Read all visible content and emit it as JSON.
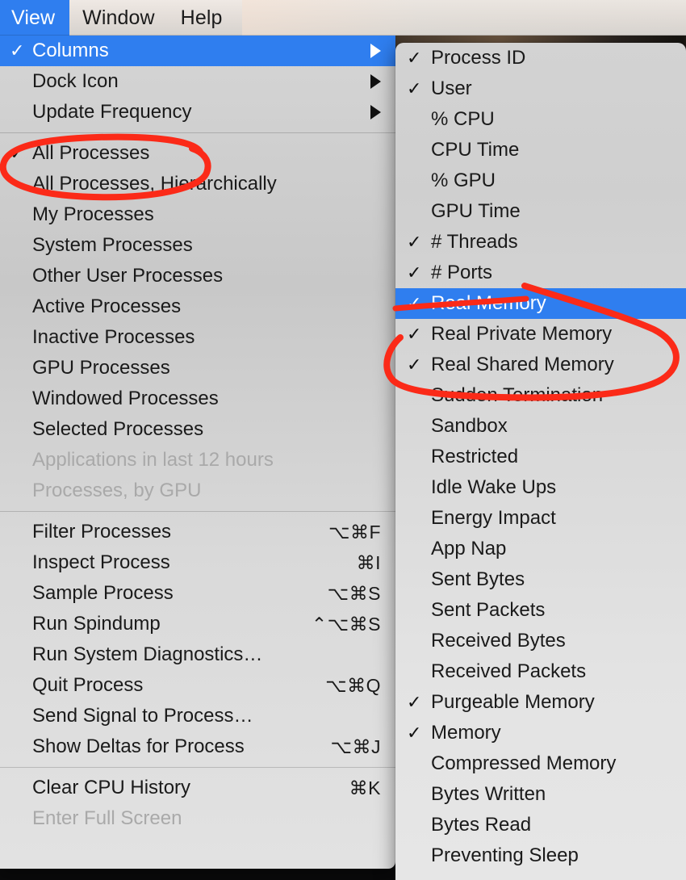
{
  "menubar": {
    "items": [
      {
        "label": "View",
        "active": true
      },
      {
        "label": "Window",
        "active": false
      },
      {
        "label": "Help",
        "active": false
      }
    ]
  },
  "view_menu": {
    "name": "View",
    "groups": [
      {
        "items": [
          {
            "label": "Columns",
            "checked": true,
            "submenu": true,
            "highlighted": true,
            "disabled": false,
            "shortcut": ""
          },
          {
            "label": "Dock Icon",
            "checked": false,
            "submenu": true,
            "highlighted": false,
            "disabled": false,
            "shortcut": ""
          },
          {
            "label": "Update Frequency",
            "checked": false,
            "submenu": true,
            "highlighted": false,
            "disabled": false,
            "shortcut": ""
          }
        ]
      },
      {
        "items": [
          {
            "label": "All Processes",
            "checked": true,
            "submenu": false,
            "highlighted": false,
            "disabled": false,
            "shortcut": ""
          },
          {
            "label": "All Processes, Hierarchically",
            "checked": false,
            "submenu": false,
            "highlighted": false,
            "disabled": false,
            "shortcut": ""
          },
          {
            "label": "My Processes",
            "checked": false,
            "submenu": false,
            "highlighted": false,
            "disabled": false,
            "shortcut": ""
          },
          {
            "label": "System Processes",
            "checked": false,
            "submenu": false,
            "highlighted": false,
            "disabled": false,
            "shortcut": ""
          },
          {
            "label": "Other User Processes",
            "checked": false,
            "submenu": false,
            "highlighted": false,
            "disabled": false,
            "shortcut": ""
          },
          {
            "label": "Active Processes",
            "checked": false,
            "submenu": false,
            "highlighted": false,
            "disabled": false,
            "shortcut": ""
          },
          {
            "label": "Inactive Processes",
            "checked": false,
            "submenu": false,
            "highlighted": false,
            "disabled": false,
            "shortcut": ""
          },
          {
            "label": "GPU Processes",
            "checked": false,
            "submenu": false,
            "highlighted": false,
            "disabled": false,
            "shortcut": ""
          },
          {
            "label": "Windowed Processes",
            "checked": false,
            "submenu": false,
            "highlighted": false,
            "disabled": false,
            "shortcut": ""
          },
          {
            "label": "Selected Processes",
            "checked": false,
            "submenu": false,
            "highlighted": false,
            "disabled": false,
            "shortcut": ""
          },
          {
            "label": "Applications in last 12 hours",
            "checked": false,
            "submenu": false,
            "highlighted": false,
            "disabled": true,
            "shortcut": ""
          },
          {
            "label": "Processes, by GPU",
            "checked": false,
            "submenu": false,
            "highlighted": false,
            "disabled": true,
            "shortcut": ""
          }
        ]
      },
      {
        "items": [
          {
            "label": "Filter Processes",
            "checked": false,
            "submenu": false,
            "highlighted": false,
            "disabled": false,
            "shortcut": "⌥⌘F"
          },
          {
            "label": "Inspect Process",
            "checked": false,
            "submenu": false,
            "highlighted": false,
            "disabled": false,
            "shortcut": "⌘I"
          },
          {
            "label": "Sample Process",
            "checked": false,
            "submenu": false,
            "highlighted": false,
            "disabled": false,
            "shortcut": "⌥⌘S"
          },
          {
            "label": "Run Spindump",
            "checked": false,
            "submenu": false,
            "highlighted": false,
            "disabled": false,
            "shortcut": "⌃⌥⌘S"
          },
          {
            "label": "Run System Diagnostics…",
            "checked": false,
            "submenu": false,
            "highlighted": false,
            "disabled": false,
            "shortcut": ""
          },
          {
            "label": "Quit Process",
            "checked": false,
            "submenu": false,
            "highlighted": false,
            "disabled": false,
            "shortcut": "⌥⌘Q"
          },
          {
            "label": "Send Signal to Process…",
            "checked": false,
            "submenu": false,
            "highlighted": false,
            "disabled": false,
            "shortcut": ""
          },
          {
            "label": "Show Deltas for Process",
            "checked": false,
            "submenu": false,
            "highlighted": false,
            "disabled": false,
            "shortcut": "⌥⌘J"
          }
        ]
      },
      {
        "items": [
          {
            "label": "Clear CPU History",
            "checked": false,
            "submenu": false,
            "highlighted": false,
            "disabled": false,
            "shortcut": "⌘K"
          },
          {
            "label": "Enter Full Screen",
            "checked": false,
            "submenu": false,
            "highlighted": false,
            "disabled": true,
            "shortcut": ""
          }
        ]
      }
    ]
  },
  "columns_menu": {
    "name": "Columns",
    "items": [
      {
        "label": "Process ID",
        "checked": true,
        "highlighted": false
      },
      {
        "label": "User",
        "checked": true,
        "highlighted": false
      },
      {
        "label": "% CPU",
        "checked": false,
        "highlighted": false
      },
      {
        "label": "CPU Time",
        "checked": false,
        "highlighted": false
      },
      {
        "label": "% GPU",
        "checked": false,
        "highlighted": false
      },
      {
        "label": "GPU Time",
        "checked": false,
        "highlighted": false
      },
      {
        "label": "# Threads",
        "checked": true,
        "highlighted": false
      },
      {
        "label": "# Ports",
        "checked": true,
        "highlighted": false
      },
      {
        "label": "Real Memory",
        "checked": true,
        "highlighted": true
      },
      {
        "label": "Real Private Memory",
        "checked": true,
        "highlighted": false
      },
      {
        "label": "Real Shared Memory",
        "checked": true,
        "highlighted": false
      },
      {
        "label": "Sudden Termination",
        "checked": false,
        "highlighted": false
      },
      {
        "label": "Sandbox",
        "checked": false,
        "highlighted": false
      },
      {
        "label": "Restricted",
        "checked": false,
        "highlighted": false
      },
      {
        "label": "Idle Wake Ups",
        "checked": false,
        "highlighted": false
      },
      {
        "label": "Energy Impact",
        "checked": false,
        "highlighted": false
      },
      {
        "label": "App Nap",
        "checked": false,
        "highlighted": false
      },
      {
        "label": "Sent Bytes",
        "checked": false,
        "highlighted": false
      },
      {
        "label": "Sent Packets",
        "checked": false,
        "highlighted": false
      },
      {
        "label": "Received Bytes",
        "checked": false,
        "highlighted": false
      },
      {
        "label": "Received Packets",
        "checked": false,
        "highlighted": false
      },
      {
        "label": "Purgeable Memory",
        "checked": true,
        "highlighted": false
      },
      {
        "label": "Memory",
        "checked": true,
        "highlighted": false
      },
      {
        "label": "Compressed Memory",
        "checked": false,
        "highlighted": false
      },
      {
        "label": "Bytes Written",
        "checked": false,
        "highlighted": false
      },
      {
        "label": "Bytes Read",
        "checked": false,
        "highlighted": false
      },
      {
        "label": "Preventing Sleep",
        "checked": false,
        "highlighted": false
      }
    ]
  },
  "annotations": {
    "color": "#fb2a18",
    "marks": [
      {
        "name": "all-processes-circle",
        "target": "All Processes"
      },
      {
        "name": "real-memory-group-circle",
        "target": "Real Memory / Real Private Memory / Real Shared Memory"
      }
    ]
  },
  "glyphs": {
    "check": "✓"
  }
}
